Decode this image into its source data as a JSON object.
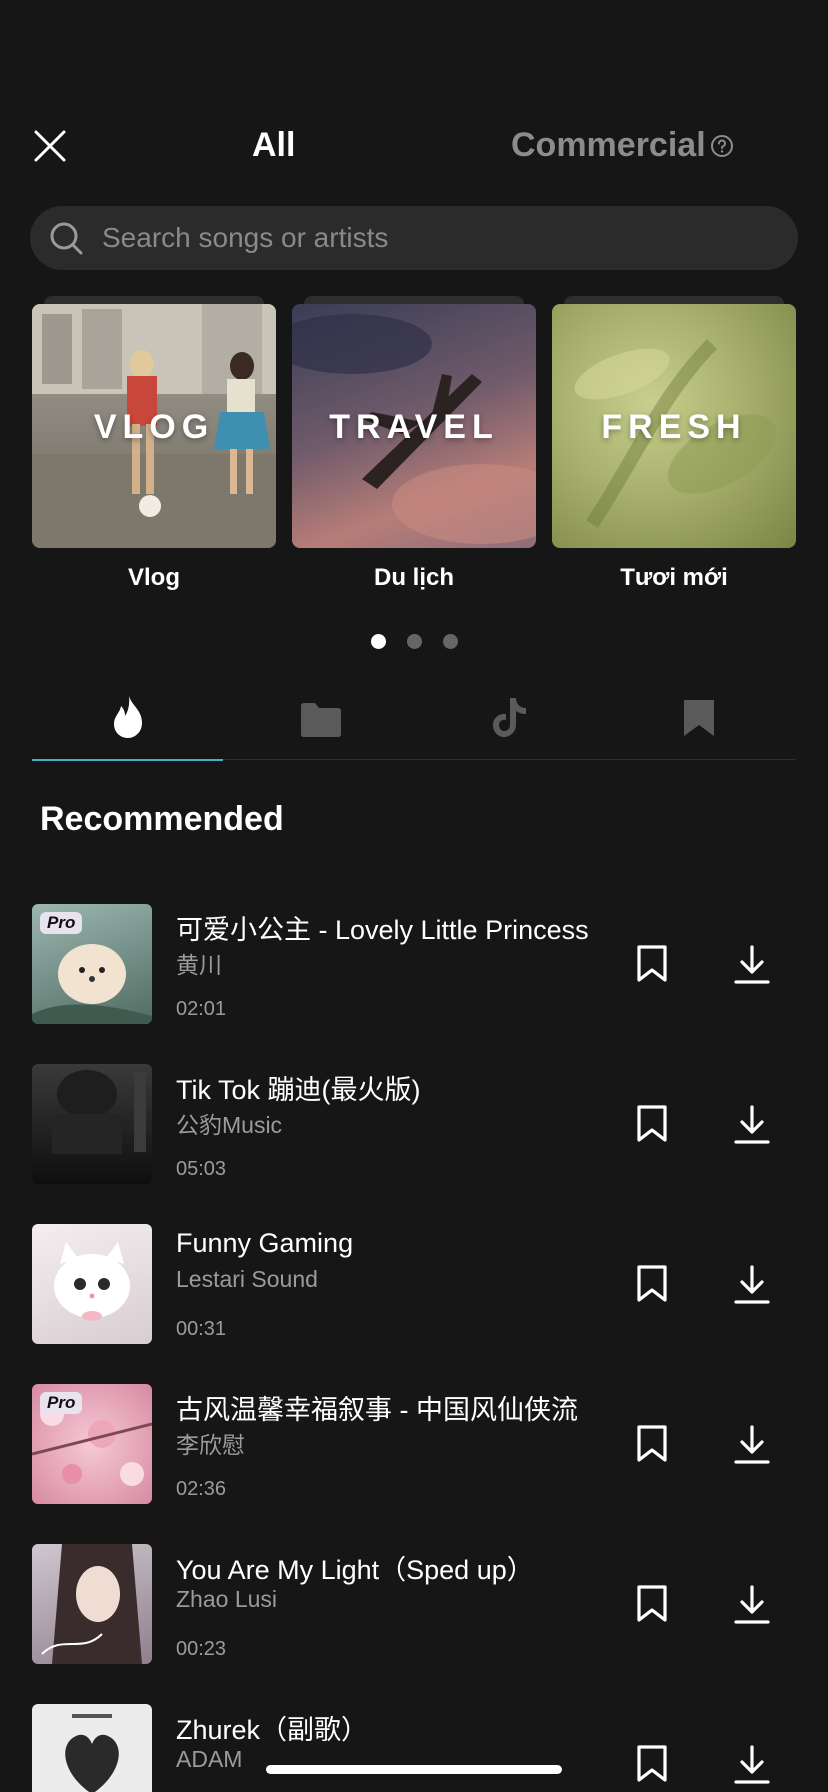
{
  "header": {
    "tab_all": "All",
    "tab_commercial": "Commercial"
  },
  "search": {
    "placeholder": "Search songs or artists"
  },
  "categories": [
    {
      "overlay": "VLOG",
      "label": "Vlog"
    },
    {
      "overlay": "TRAVEL",
      "label": "Du lịch"
    },
    {
      "overlay": "FRESH",
      "label": "Tươi mới"
    }
  ],
  "pager": {
    "pages": 3,
    "active": 1
  },
  "tabs": [
    {
      "icon": "flame-icon",
      "active": true
    },
    {
      "icon": "folder-icon",
      "active": false
    },
    {
      "icon": "tiktok-icon",
      "active": false
    },
    {
      "icon": "bookmark-icon",
      "active": false
    }
  ],
  "section": {
    "title": "Recommended"
  },
  "songs": [
    {
      "title": "可爱小公主 - Lovely Little Princess",
      "artist": "黄川",
      "duration": "02:01",
      "pro": "Pro"
    },
    {
      "title": "Tik Tok 蹦迪(最火版)",
      "artist": "公豹Music",
      "duration": "05:03",
      "pro": ""
    },
    {
      "title": "Funny Gaming",
      "artist": "Lestari Sound",
      "duration": "00:31",
      "pro": ""
    },
    {
      "title": "古风温馨幸福叙事 - 中国风仙侠流",
      "artist": "李欣慰",
      "duration": "02:36",
      "pro": "Pro"
    },
    {
      "title": "You Are My Light（Sped up）",
      "artist": "Zhao Lusi",
      "duration": "00:23",
      "pro": ""
    },
    {
      "title": "Zhurek（副歌）",
      "artist": "ADAM",
      "duration": "",
      "pro": ""
    }
  ],
  "colors": {
    "background": "#161616",
    "accent": "#3fb6c4",
    "muted": "#9b9b9b"
  }
}
